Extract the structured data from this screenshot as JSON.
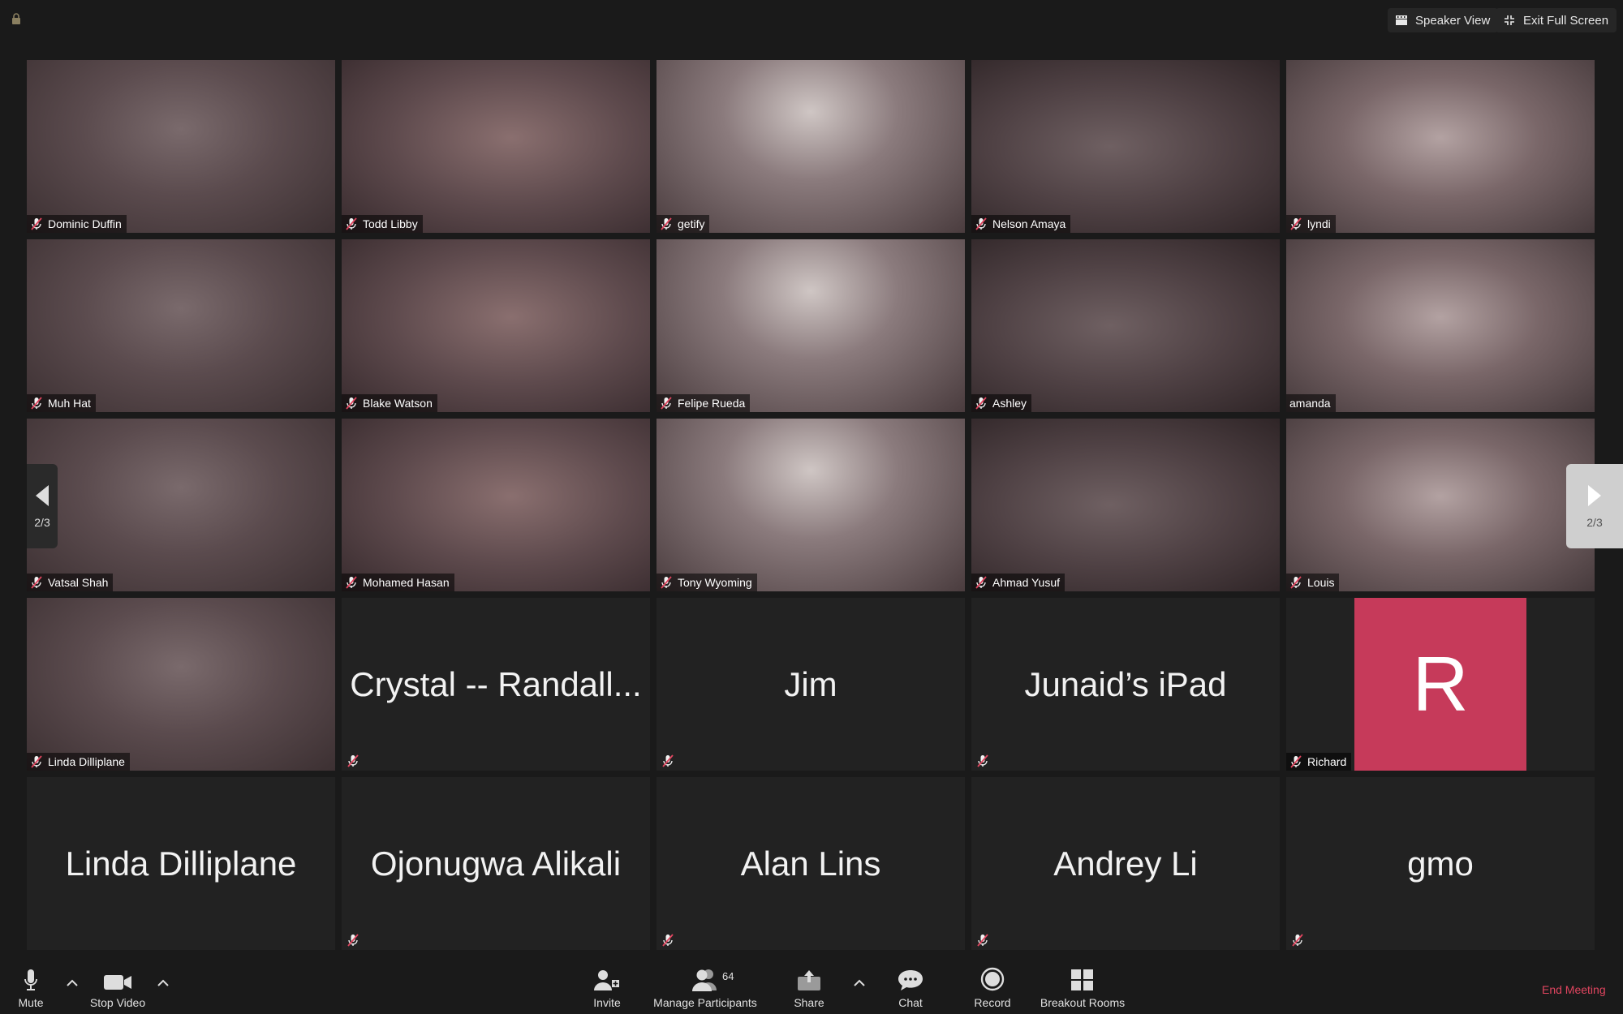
{
  "window": {
    "lock_icon": "lock-icon"
  },
  "top_buttons": {
    "speaker_view": "Speaker View",
    "exit_full_screen": "Exit Full Screen"
  },
  "pager": {
    "left_label": "2/3",
    "right_label": "2/3"
  },
  "participants": [
    {
      "name": "Dominic Duffin",
      "video": true,
      "muted": true
    },
    {
      "name": "Todd Libby",
      "video": true,
      "muted": true
    },
    {
      "name": "getify",
      "video": true,
      "muted": true
    },
    {
      "name": "Nelson Amaya",
      "video": true,
      "muted": true
    },
    {
      "name": "lyndi",
      "video": true,
      "muted": true
    },
    {
      "name": "Muh Hat",
      "video": true,
      "muted": true
    },
    {
      "name": "Blake Watson",
      "video": true,
      "muted": true
    },
    {
      "name": "Felipe Rueda",
      "video": true,
      "muted": true
    },
    {
      "name": "Ashley",
      "video": true,
      "muted": true
    },
    {
      "name": "amanda",
      "video": true,
      "muted": false
    },
    {
      "name": "Vatsal Shah",
      "video": true,
      "muted": true
    },
    {
      "name": "Mohamed Hasan",
      "video": true,
      "muted": true
    },
    {
      "name": "Tony Wyoming",
      "video": true,
      "muted": true
    },
    {
      "name": "Ahmad Yusuf",
      "video": true,
      "muted": true
    },
    {
      "name": "Louis",
      "video": true,
      "muted": true
    },
    {
      "name": "Linda Dilliplane",
      "video": true,
      "muted": true
    },
    {
      "name": "Crystal -- Randall...",
      "video": false,
      "muted": true
    },
    {
      "name": "Jim",
      "video": false,
      "muted": true
    },
    {
      "name": "Junaid’s iPad",
      "video": false,
      "muted": true
    },
    {
      "name": "Richard",
      "video": false,
      "muted": true,
      "avatar_letter": "R",
      "avatar_color": "#c63a5a"
    },
    {
      "name": "Linda Dilliplane",
      "video": false,
      "muted": false
    },
    {
      "name": "Ojonugwa Alikali",
      "video": false,
      "muted": true
    },
    {
      "name": "Alan Lins",
      "video": false,
      "muted": true
    },
    {
      "name": "Andrey Li",
      "video": false,
      "muted": true
    },
    {
      "name": "gmo",
      "video": false,
      "muted": true
    }
  ],
  "toolbar": {
    "mute": "Mute",
    "stop_video": "Stop Video",
    "invite": "Invite",
    "manage_participants": "Manage Participants",
    "participant_count": "64",
    "share": "Share",
    "chat": "Chat",
    "record": "Record",
    "breakout_rooms": "Breakout Rooms",
    "end_meeting": "End Meeting"
  },
  "colors": {
    "end_meeting": "#e0455f",
    "avatar_r": "#c63a5a",
    "background": "#1a1a1a"
  }
}
